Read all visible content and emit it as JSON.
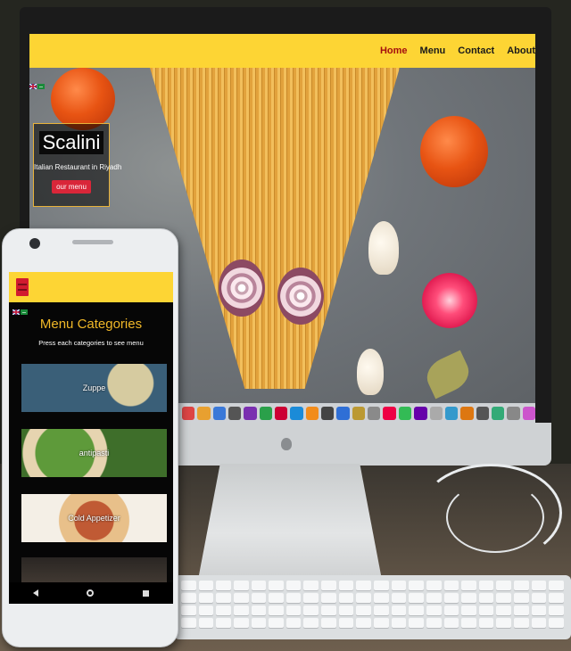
{
  "desktop_site": {
    "nav": {
      "items": [
        "Home",
        "Menu",
        "Contact",
        "About"
      ]
    },
    "hero": {
      "brand_title": "Scalini",
      "brand_subtitle": "Italian Restaurant in Riyadh",
      "cta_label": "our menu"
    }
  },
  "mobile_site": {
    "heading": "Menu Categories",
    "subtitle": "Press each categories to see menu",
    "categories": [
      {
        "label": "Zuppe"
      },
      {
        "label": "antipasti"
      },
      {
        "label": "Cold Appetizer"
      }
    ]
  },
  "colors": {
    "nav_yellow": "#fdd534",
    "active_red": "#a50f0f",
    "heading_gold": "#f0b828",
    "cta_red": "#d92639"
  },
  "icons": [
    "apple-logo-icon",
    "hamburger-menu-icon",
    "uk-flag-icon",
    "saudi-flag-icon",
    "back-icon",
    "home-icon",
    "recent-apps-icon"
  ]
}
